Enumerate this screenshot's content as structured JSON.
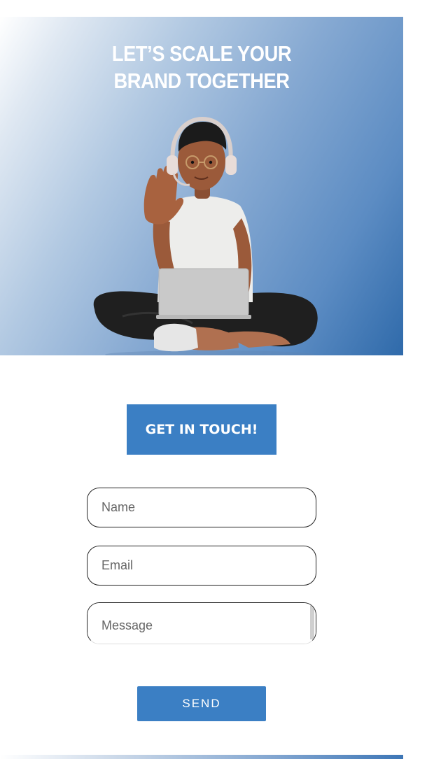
{
  "hero": {
    "title_line1": "LET’S SCALE YOUR",
    "title_line2": "BRAND TOGETHER",
    "illustration": "person-with-laptop-waving"
  },
  "cta": {
    "label": "GET IN TOUCH!"
  },
  "form": {
    "name_placeholder": "Name",
    "email_placeholder": "Email",
    "message_placeholder": "Message",
    "send_label": "SEND"
  },
  "colors": {
    "accent": "#3b7fc4",
    "hero_gradient_end": "#2f6aaa",
    "background": "#ffffff"
  }
}
